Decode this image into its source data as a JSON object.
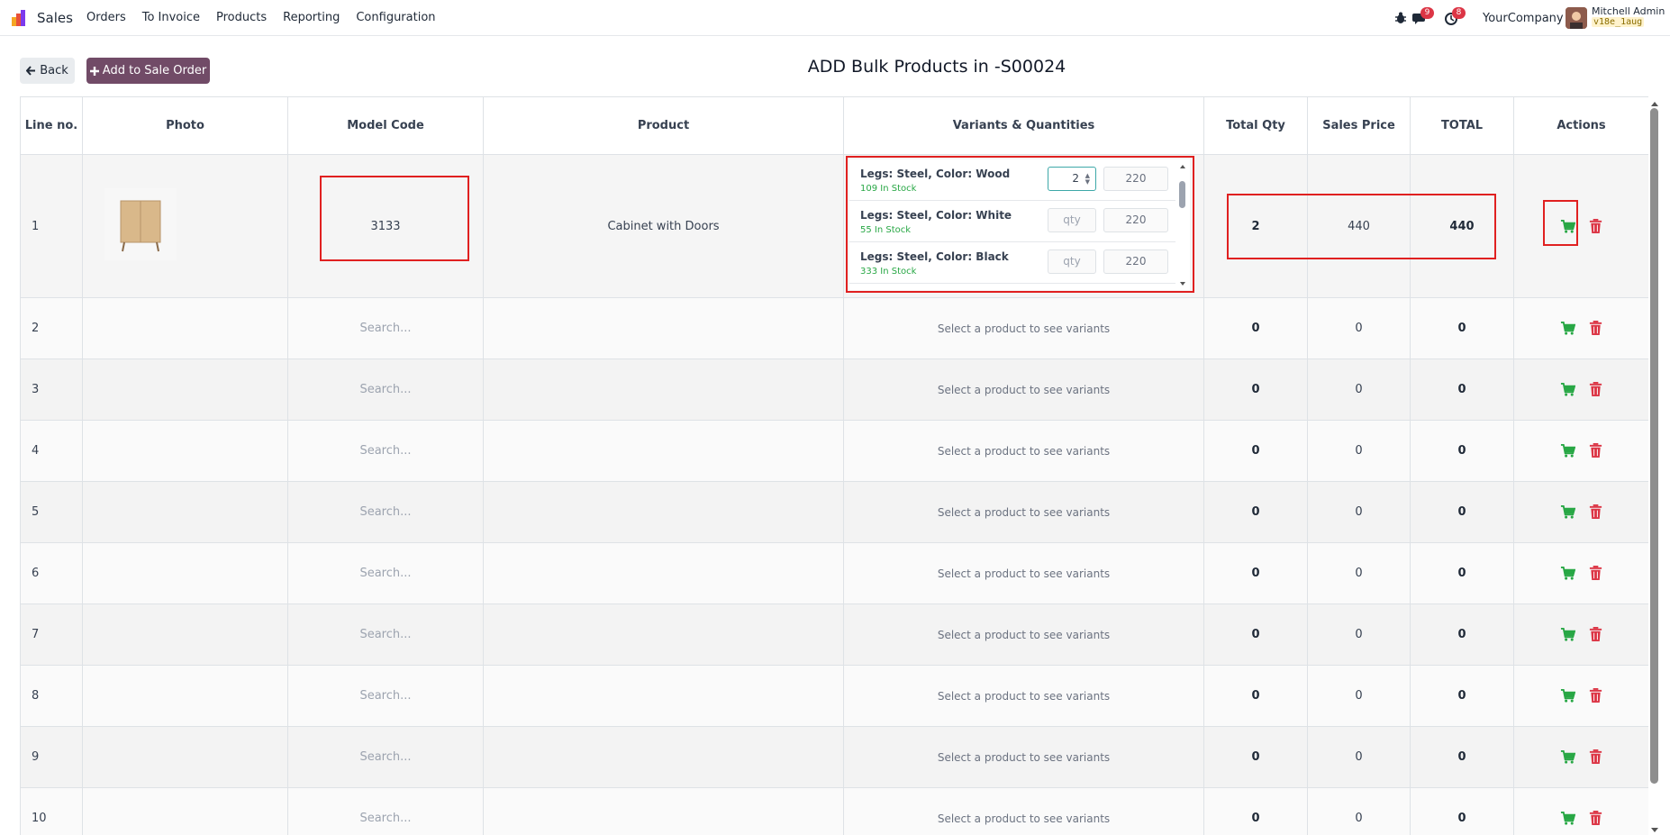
{
  "navbar": {
    "app_name": "Sales",
    "menu": [
      "Orders",
      "To Invoice",
      "Products",
      "Reporting",
      "Configuration"
    ],
    "messages_count": "9",
    "activities_count": "8",
    "company": "YourCompany",
    "user_name": "Mitchell Admin",
    "db_name": "v18e_1aug"
  },
  "toolbar": {
    "back_label": "Back",
    "add_label": "Add to Sale Order",
    "title": "ADD Bulk Products in -S00024"
  },
  "table": {
    "headers": [
      "Line no.",
      "Photo",
      "Model Code",
      "Product",
      "Variants & Quantities",
      "Total Qty",
      "Sales Price",
      "TOTAL",
      "Actions"
    ],
    "first_row": {
      "line": "1",
      "model_code": "3133",
      "product": "Cabinet with Doors",
      "total_qty": "2",
      "sales_price": "440",
      "total": "440",
      "variants": [
        {
          "name": "Legs: Steel, Color: Wood",
          "stock": "109 In Stock",
          "qty": "2",
          "price": "220"
        },
        {
          "name": "Legs: Steel, Color: White",
          "stock": "55 In Stock",
          "qty": "qty",
          "price": "220"
        },
        {
          "name": "Legs: Steel, Color: Black",
          "stock": "333 In Stock",
          "qty": "qty",
          "price": "220"
        }
      ]
    },
    "rows": [
      {
        "line": "2",
        "model_placeholder": "Search...",
        "variants_hint": "Select a product to see variants",
        "total_qty": "0",
        "sales_price": "0",
        "total": "0"
      },
      {
        "line": "3",
        "model_placeholder": "Search...",
        "variants_hint": "Select a product to see variants",
        "total_qty": "0",
        "sales_price": "0",
        "total": "0"
      },
      {
        "line": "4",
        "model_placeholder": "Search...",
        "variants_hint": "Select a product to see variants",
        "total_qty": "0",
        "sales_price": "0",
        "total": "0"
      },
      {
        "line": "5",
        "model_placeholder": "Search...",
        "variants_hint": "Select a product to see variants",
        "total_qty": "0",
        "sales_price": "0",
        "total": "0"
      },
      {
        "line": "6",
        "model_placeholder": "Search...",
        "variants_hint": "Select a product to see variants",
        "total_qty": "0",
        "sales_price": "0",
        "total": "0"
      },
      {
        "line": "7",
        "model_placeholder": "Search...",
        "variants_hint": "Select a product to see variants",
        "total_qty": "0",
        "sales_price": "0",
        "total": "0"
      },
      {
        "line": "8",
        "model_placeholder": "Search...",
        "variants_hint": "Select a product to see variants",
        "total_qty": "0",
        "sales_price": "0",
        "total": "0"
      },
      {
        "line": "9",
        "model_placeholder": "Search...",
        "variants_hint": "Select a product to see variants",
        "total_qty": "0",
        "sales_price": "0",
        "total": "0"
      },
      {
        "line": "10",
        "model_placeholder": "Search...",
        "variants_hint": "Select a product to see variants",
        "total_qty": "0",
        "sales_price": "0",
        "total": "0"
      }
    ]
  },
  "colors": {
    "brand": "#714b67",
    "cart": "#28a745",
    "trash": "#dc3545",
    "highlight": "#e02020"
  },
  "icons": {
    "back": "arrow-left-icon",
    "add": "plus-icon",
    "cart": "cart-icon",
    "trash": "trash-icon"
  }
}
